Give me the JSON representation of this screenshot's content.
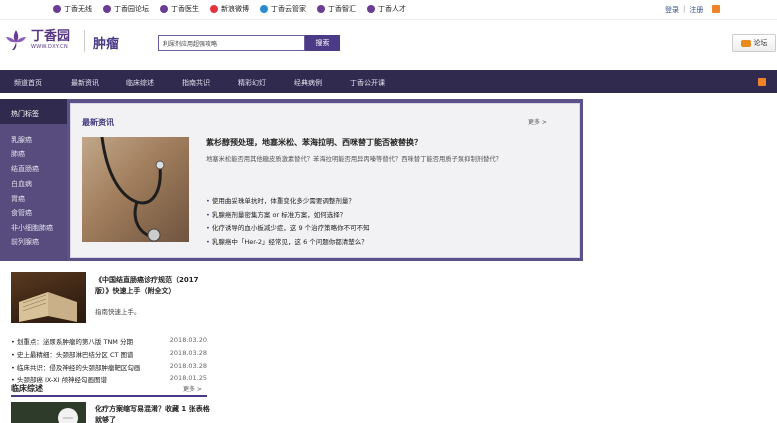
{
  "topbar": {
    "links": [
      {
        "label": "丁香无线",
        "icon": "phone-icon"
      },
      {
        "label": "丁香园论坛",
        "icon": "forum-icon"
      },
      {
        "label": "丁香医生",
        "icon": "doctor-icon"
      },
      {
        "label": "新浪微博",
        "icon": "weibo-icon"
      },
      {
        "label": "丁香云管家",
        "icon": "cloud-icon"
      },
      {
        "label": "丁香智汇",
        "icon": "smart-icon"
      },
      {
        "label": "丁香人才",
        "icon": "talent-icon"
      }
    ],
    "login": "登录",
    "divider": "|",
    "register": "注册"
  },
  "header": {
    "logo_title": "丁香园",
    "logo_url": "WWW.DXY.CN",
    "section": "肿瘤",
    "search_value": "利尿剂应用超强攻略",
    "search_button": "搜索",
    "forum_button": "论坛"
  },
  "nav": {
    "items": [
      "频道首页",
      "最新资讯",
      "临床综述",
      "指南共识",
      "精彩幻灯",
      "经典病例",
      "丁香公开课"
    ]
  },
  "sidebar": {
    "heading": "热门标签",
    "items": [
      "乳腺癌",
      "肺癌",
      "结直肠癌",
      "白血病",
      "胃癌",
      "食管癌",
      "非小细胞肺癌",
      "前列腺癌"
    ]
  },
  "latest": {
    "title": "最新资讯",
    "more": "更多 >",
    "headline": "紫杉醇预处理，地塞米松、苯海拉明、西咪替丁能否被替换？",
    "summary": "地塞米松能否用其他糖皮质激素替代？苯海拉明能否用异丙嗪等替代？西咪替丁能否用质子泵抑制剂替代？",
    "bullets": [
      "使用曲妥珠单抗时，体重变化多少需要调整剂量？",
      "乳腺癌剂量密集方案 or 标准方案，如何选择？",
      "化疗诱导的血小板减少症，这 9 个治疗策略你不可不知",
      "乳腺癌中「Her-2」经常见，这 6 个问题你都清楚么？"
    ]
  },
  "feature": {
    "title": "《中国结直肠癌诊疗规范（2017 版）》快速上手（附全文）",
    "desc": "指南快速上手。"
  },
  "news_list": [
    {
      "title": "划重点：泌尿系肿瘤的第八版 TNM 分期",
      "date": "2018.03.20"
    },
    {
      "title": "史上最精细：头颈部淋巴结分区 CT 图谱",
      "date": "2018.03.28"
    },
    {
      "title": "临床共识：侵及神经的头颈部肿瘤靶区勾画",
      "date": "2018.03.28"
    },
    {
      "title": "头颈部癌 IX-XI 颅神经勾画图谱",
      "date": "2018.01.25"
    }
  ],
  "clinical": {
    "title": "临床综述",
    "more": "更多 >",
    "item_title": "化疗方案缩写易混淆？收藏 1 张表格就够了"
  },
  "colors": {
    "brand": "#4b3a86",
    "nav_bg": "#2f2a4e",
    "sidebar_bg": "#574c7d",
    "rss": "#f0832a"
  }
}
